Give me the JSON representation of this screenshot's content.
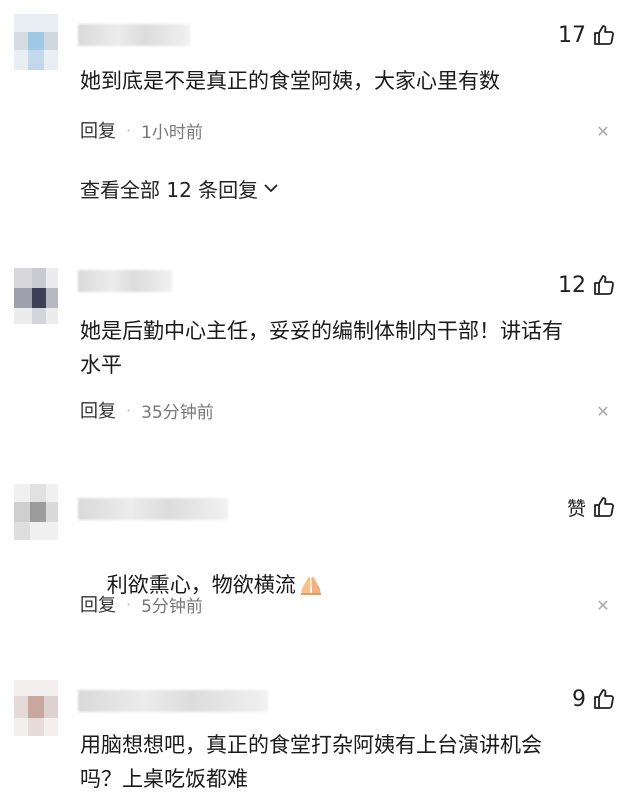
{
  "comments": [
    {
      "likes": "17",
      "text": "她到底是不是真正的食堂阿姨，大家心里有数",
      "reply_label": "回复",
      "time": "1小时前",
      "view_all": "查看全部 12 条回复"
    },
    {
      "likes": "12",
      "text": "她是后勤中心主任，妥妥的编制体制内干部！讲话有\n水平",
      "reply_label": "回复",
      "time": "35分钟前"
    },
    {
      "likes": "赞",
      "text": "利欲熏心，物欲横流",
      "reply_label": "回复",
      "time": "5分钟前"
    },
    {
      "likes": "9",
      "text": "用脑想想吧，真正的食堂打杂阿姨有上台演讲机会\n吗？上桌吃饭都难"
    }
  ],
  "icons": {
    "like": "thumbs-up-icon",
    "close": "close-icon",
    "chevron": "chevron-down-icon",
    "pray": "pray-hands-emoji"
  },
  "colors": {
    "text": "#1a1a1a",
    "meta": "#777777",
    "close": "#aaaaaa"
  }
}
